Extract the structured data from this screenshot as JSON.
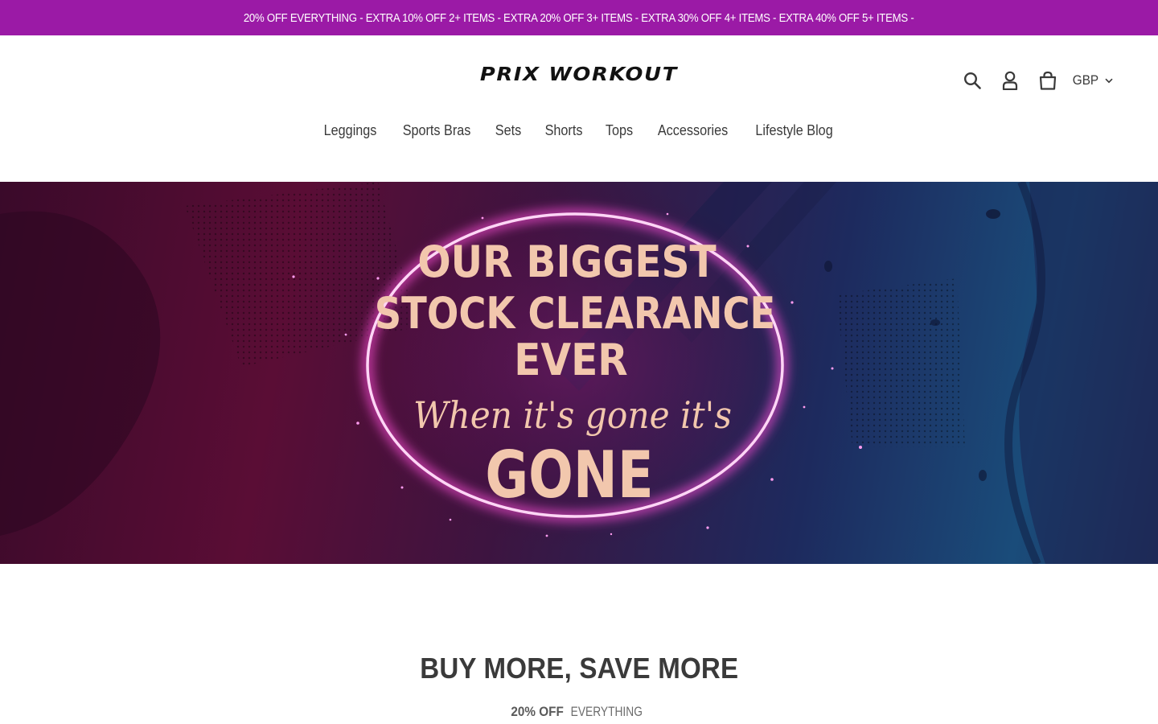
{
  "announcement": {
    "text": "20% OFF EVERYTHING - EXTRA 10% OFF 2+ ITEMS - EXTRA 20% OFF 3+ ITEMS - EXTRA 30% OFF 4+ ITEMS - EXTRA 40% OFF 5+ ITEMS -",
    "background": "#9b1aa6"
  },
  "header": {
    "logo_text": "PRIX WORKOUT",
    "icons": [
      "search-icon",
      "account-icon",
      "cart-icon"
    ],
    "currency": "GBP"
  },
  "nav": {
    "items": [
      "Leggings",
      "Sports Bras",
      "Sets",
      "Shorts",
      "Tops",
      "Accessories",
      "Lifestyle Blog"
    ]
  },
  "hero": {
    "line1": "OUR BIGGEST",
    "line2": "STOCK CLEARANCE",
    "line3": "EVER",
    "line4": "When it's gone it's",
    "line5": "GONE",
    "text_color": "#f3c9b0",
    "ring_color": "#ff7be6"
  },
  "section": {
    "title": "BUY MORE, SAVE MORE",
    "sub_bold": "20% OFF",
    "sub_rest": "EVERYTHING"
  }
}
